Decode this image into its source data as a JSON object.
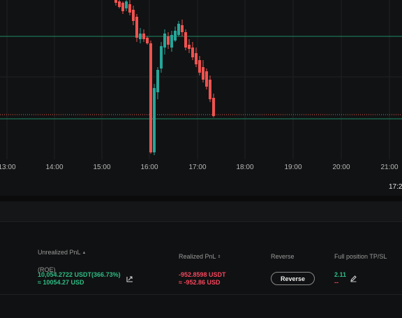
{
  "chart": {
    "time_labels": [
      "13:00",
      "14:00",
      "15:00",
      "16:00",
      "17:00",
      "18:00",
      "19:00",
      "20:00",
      "21:00"
    ],
    "cursor_time": "17:2",
    "colors": {
      "background": "#111213",
      "grid": "#1f2123",
      "up_candle": "#26a69a",
      "down_candle": "#ef5350",
      "level_line": "#1f8a66",
      "price_line": "#e0584f"
    }
  },
  "positions": {
    "headers": {
      "unrealized_pnl_line1": "Unrealized PnL",
      "unrealized_pnl_line2": "(ROE)",
      "realized_pnl": "Realized PnL",
      "reverse": "Reverse",
      "full_tpsl": "Full position TP/SL"
    },
    "row": {
      "unrealized_pnl": "10,054.2722 USDT(366.73%)",
      "unrealized_pnl_usd": "≈ 10054.27 USD",
      "realized_pnl": "-952.8598 USDT",
      "realized_pnl_usd": "≈ -952.86 USD",
      "reverse_label": "Reverse",
      "tp_value": "2.11",
      "sl_value": "--"
    },
    "icons": {
      "sort": "sort-icon",
      "share": "share-icon",
      "edit": "edit-icon"
    }
  }
}
